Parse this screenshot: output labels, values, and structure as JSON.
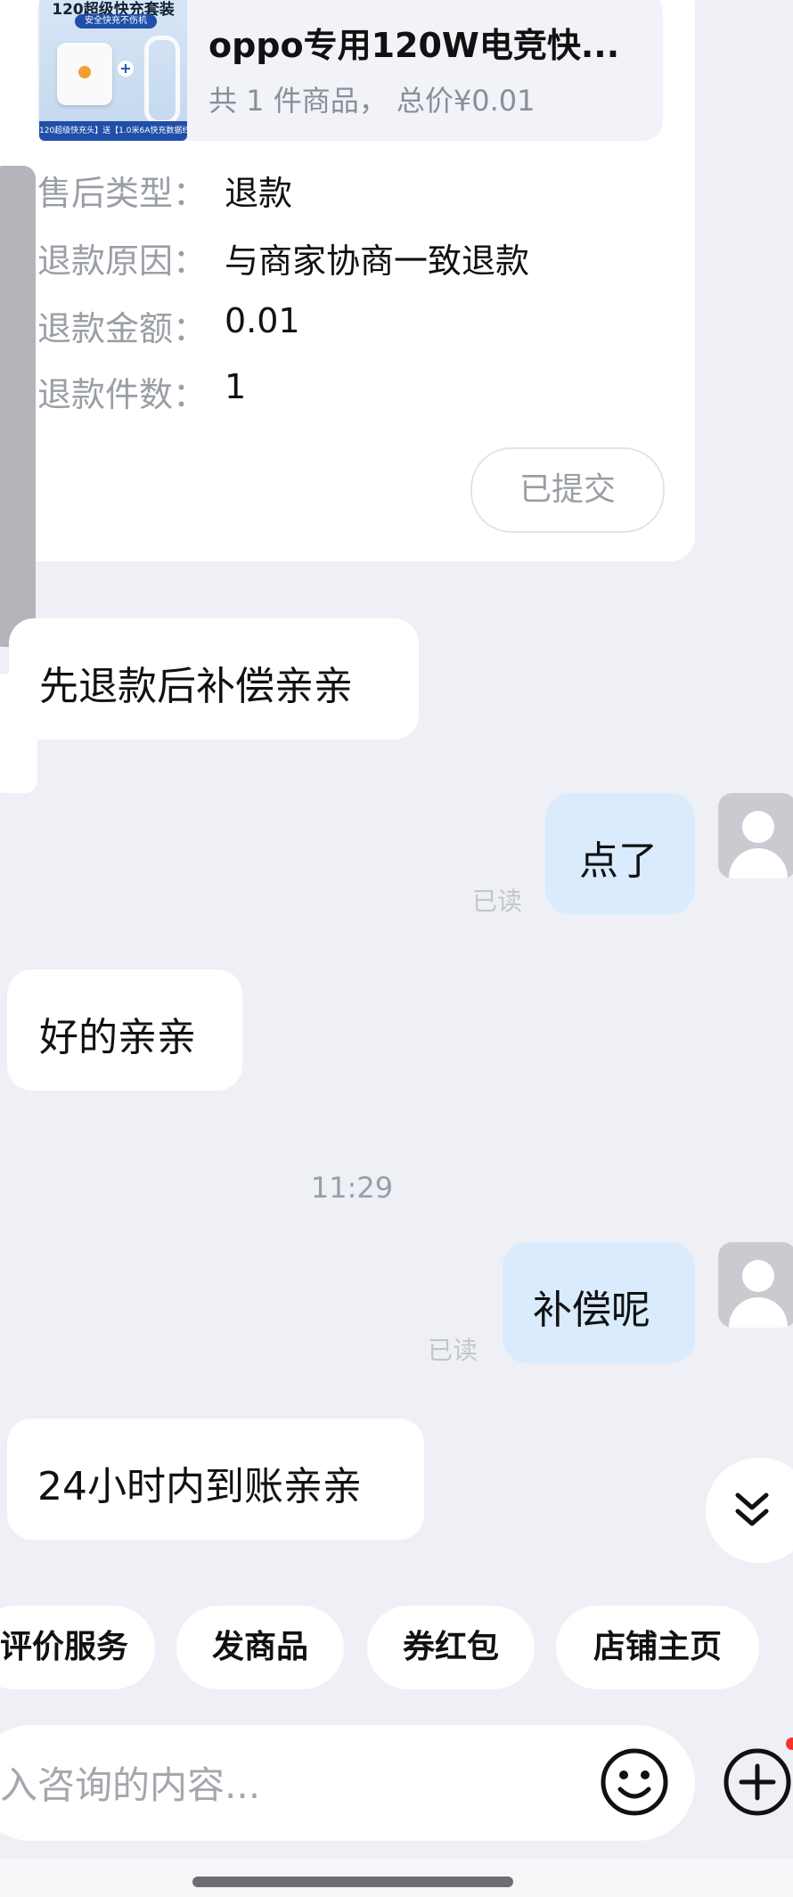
{
  "refund_card": {
    "product": {
      "image_title": "120超级快充套装",
      "image_tag": "安全快充不伤机",
      "image_bottom": "120超级快充头】送【1.0米6A快充数据线",
      "name": "oppo专用120W电竞快...",
      "meta": "共 1 件商品， 总价¥0.01"
    },
    "rows": [
      {
        "label": "售后类型：",
        "value": "退款"
      },
      {
        "label": "退款原因：",
        "value": "与商家协商一致退款"
      },
      {
        "label": "退款金额：",
        "value": "0.01"
      },
      {
        "label": "退款件数：",
        "value": "1"
      }
    ],
    "status_button": "已提交"
  },
  "messages": [
    {
      "side": "left",
      "text": "先退款后补偿亲亲"
    },
    {
      "side": "right",
      "text": "点了",
      "read": "已读"
    },
    {
      "side": "left",
      "text": "好的亲亲"
    },
    {
      "side": "right",
      "text": "补偿呢",
      "read": "已读"
    },
    {
      "side": "left",
      "text": "24小时内到账亲亲"
    }
  ],
  "timestamp": "11:29",
  "quick_chips": [
    "评价服务",
    "发商品",
    "券红包",
    "店铺主页"
  ],
  "input": {
    "placeholder": "入咨询的内容..."
  },
  "icons": {
    "emoji": "smiley-icon",
    "plus": "plus-circle-icon",
    "scroll": "double-chevron-down-icon",
    "avatar": "user-avatar-icon"
  },
  "colors": {
    "background": "#eef0f5",
    "right_bubble": "#d9ebfc",
    "badge": "#f0352f"
  }
}
